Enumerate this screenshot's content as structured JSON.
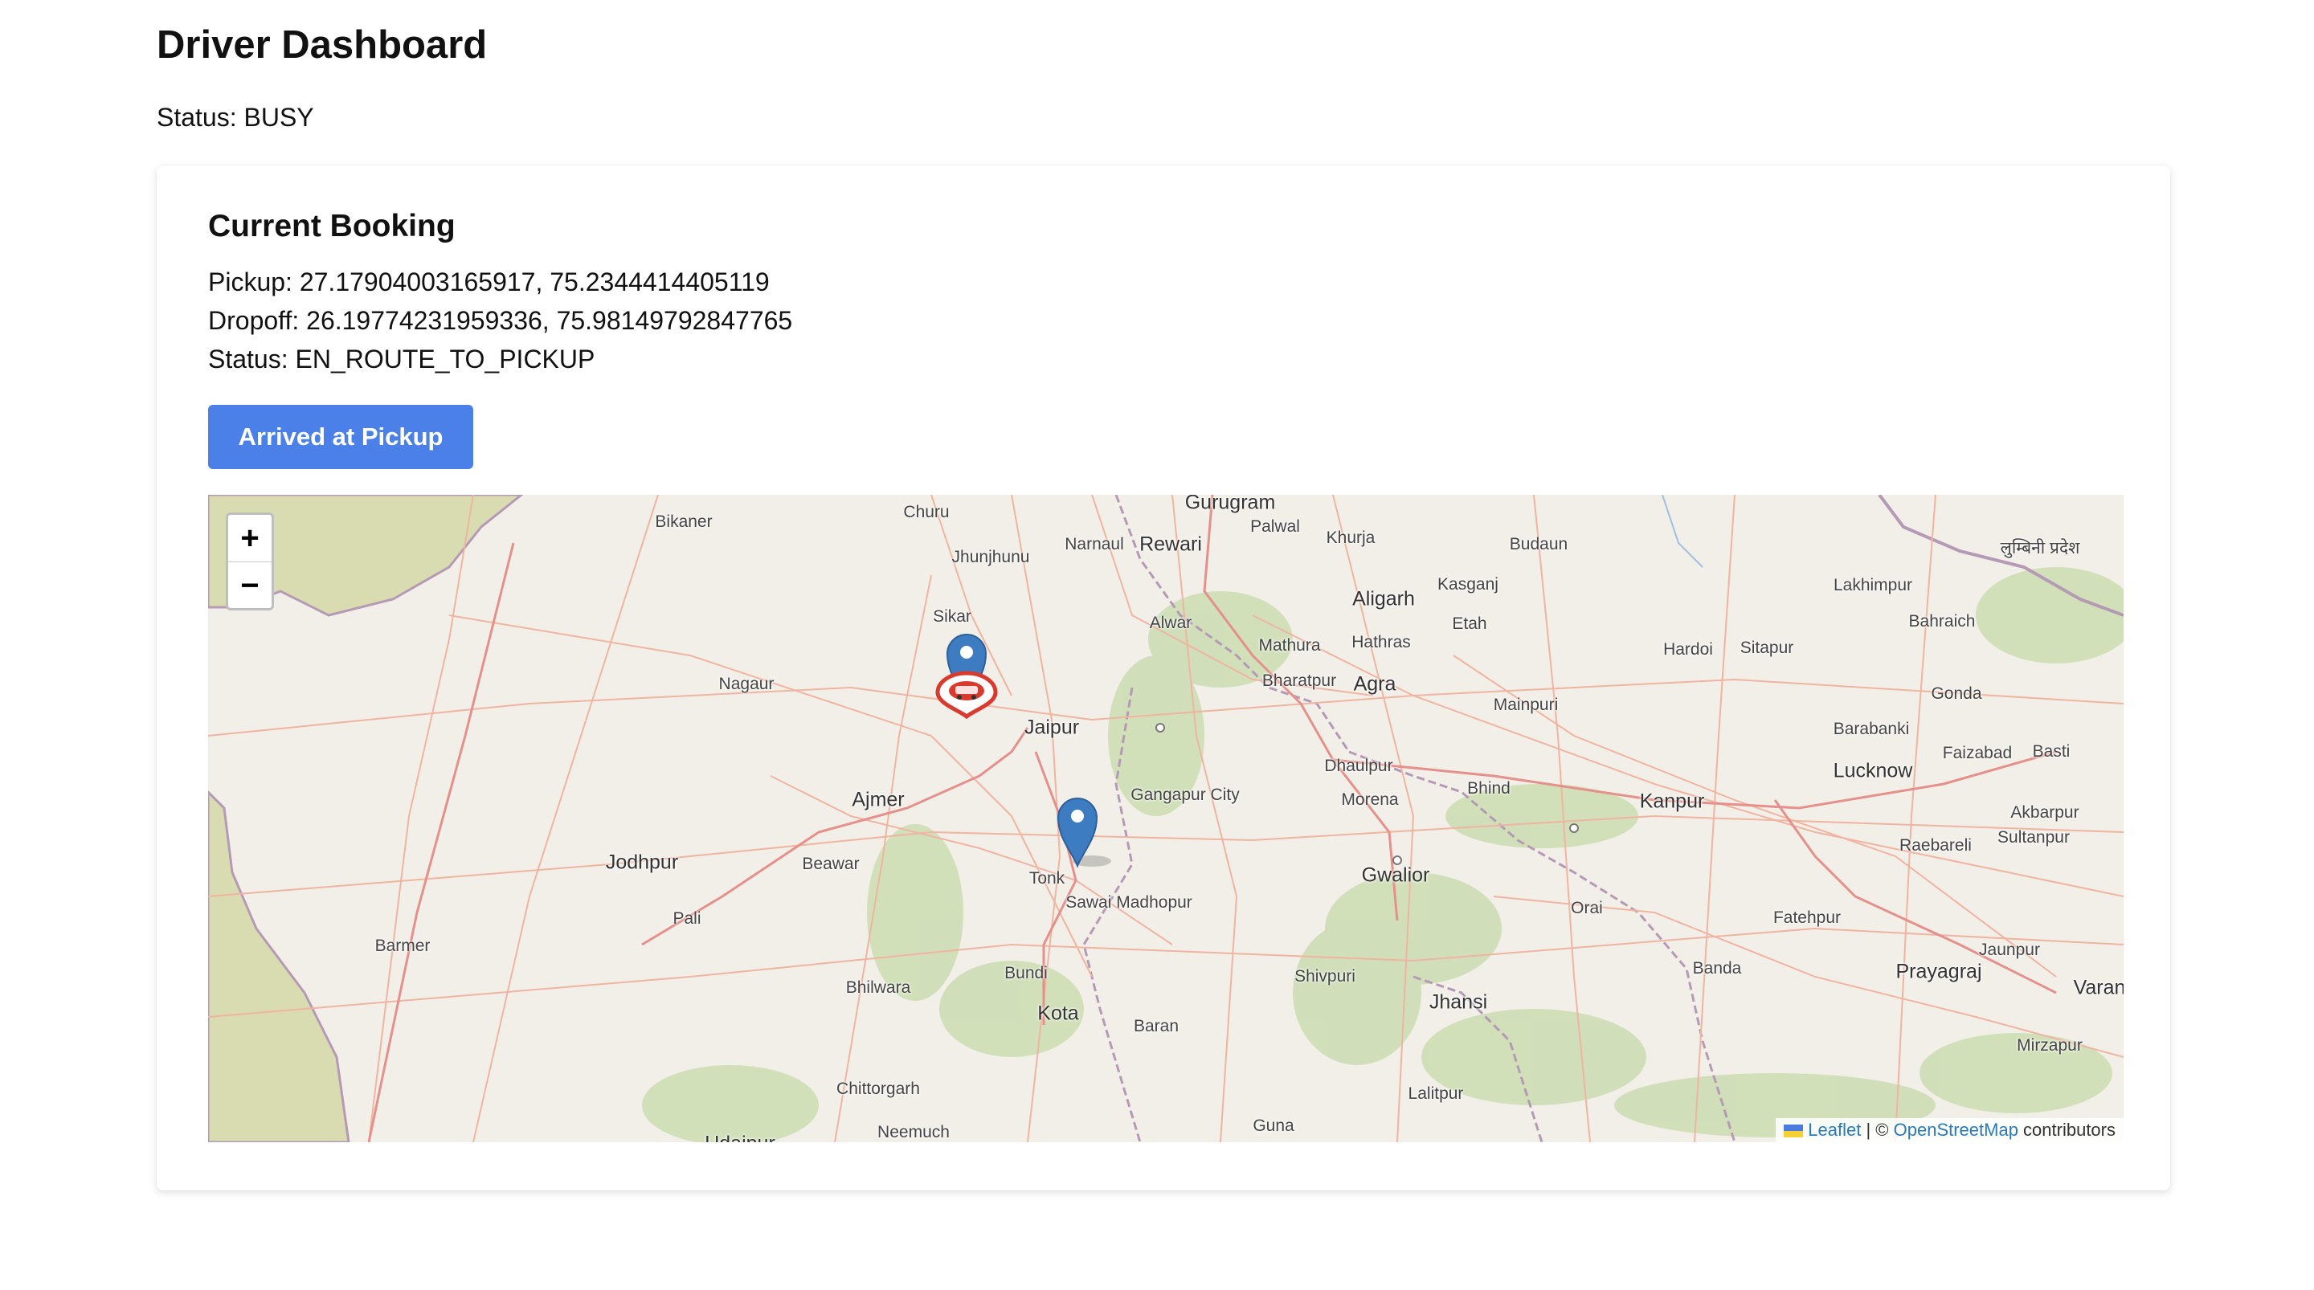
{
  "page": {
    "title": "Driver Dashboard",
    "driver_status": "Status: BUSY"
  },
  "booking": {
    "heading": "Current Booking",
    "pickup": "Pickup: 27.17904003165917, 75.2344414405119",
    "dropoff": "Dropoff: 26.19774231959336, 75.98149792847765",
    "status": "Status: EN_ROUTE_TO_PICKUP",
    "action_label": "Arrived at Pickup"
  },
  "map": {
    "zoom_in": "+",
    "zoom_out": "−",
    "attribution": {
      "leaflet": "Leaflet",
      "separator": " | © ",
      "osm": "OpenStreetMap",
      "contributors": " contributors"
    },
    "places": [
      "Bikaner",
      "Churu",
      "Jhunjhunu",
      "Narnaul",
      "Rewari",
      "Gurugram",
      "Palwal",
      "Khurja",
      "Budaun",
      "लुम्बिनी प्रदेश",
      "Kasganj",
      "Lakhimpur",
      "Sikar",
      "Aligarh",
      "Alwar",
      "Etah",
      "Bahraich",
      "Mathura",
      "Hathras",
      "Hardoi",
      "Sitapur",
      "Nagaur",
      "Bharatpur",
      "Agra",
      "Mainpuri",
      "Gonda",
      "Jaipur",
      "Barabanki",
      "Lucknow",
      "Faizabad",
      "Basti",
      "Dhaulpur",
      "Gangapur City",
      "Bhind",
      "Ajmer",
      "Morena",
      "Kanpur",
      "Akbarpur",
      "Raebareli",
      "Sultanpur",
      "Jodhpur",
      "Beawar",
      "Tonk",
      "Gwalior",
      "Sawai Madhopur",
      "Orai",
      "Pali",
      "Fatehpur",
      "Barmer",
      "Jaunpur",
      "Bhilwara",
      "Bundi",
      "Shivpuri",
      "Banda",
      "Prayagraj",
      "Varan",
      "Kota",
      "Jhansi",
      "Baran",
      "Mirzapur",
      "Chittorgarh",
      "Lalitpur",
      "Neemuch",
      "Guna",
      "Udaipur"
    ],
    "colors": {
      "land": "#f2efe9",
      "desert": "#d9dcb0",
      "forest": "#cddeb4",
      "road": "#f0b4a0",
      "border": "#b59ab5",
      "marker": "#3e7cc2",
      "car_marker": "#d93a2e"
    }
  }
}
